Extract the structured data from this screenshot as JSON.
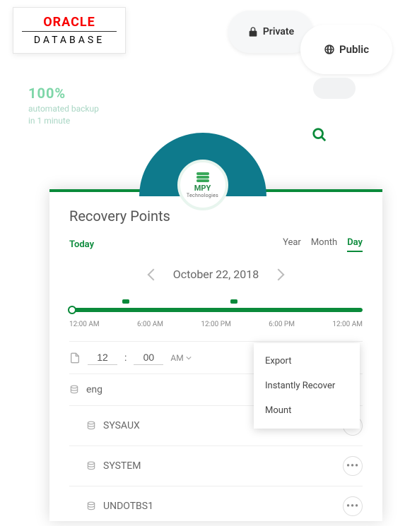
{
  "top": {
    "oracle_name": "ORACLE",
    "oracle_sub": "DATABASE",
    "private_label": "Private",
    "public_label": "Public",
    "mpy_name": "MPY",
    "mpy_sub": "Technologies"
  },
  "blurb": {
    "line1": "100%",
    "line2": "automated backup",
    "line3": "in 1 minute"
  },
  "panel": {
    "title": "Recovery Points",
    "today": "Today",
    "ranges": {
      "year": "Year",
      "month": "Month",
      "day": "Day"
    },
    "date": "October 22, 2018",
    "ticks": [
      "12:00 AM",
      "6:00 AM",
      "12:00 PM",
      "6:00 PM",
      "12:00 AM"
    ],
    "time": {
      "hour": "12",
      "sep": ":",
      "minute": "00",
      "ampm": "AM"
    },
    "menu": {
      "export": "Export",
      "recover": "Instantly Recover",
      "mount": "Mount"
    },
    "tree": {
      "root": "eng",
      "children": [
        "SYSAUX",
        "SYSTEM",
        "UNDOTBS1"
      ]
    }
  }
}
